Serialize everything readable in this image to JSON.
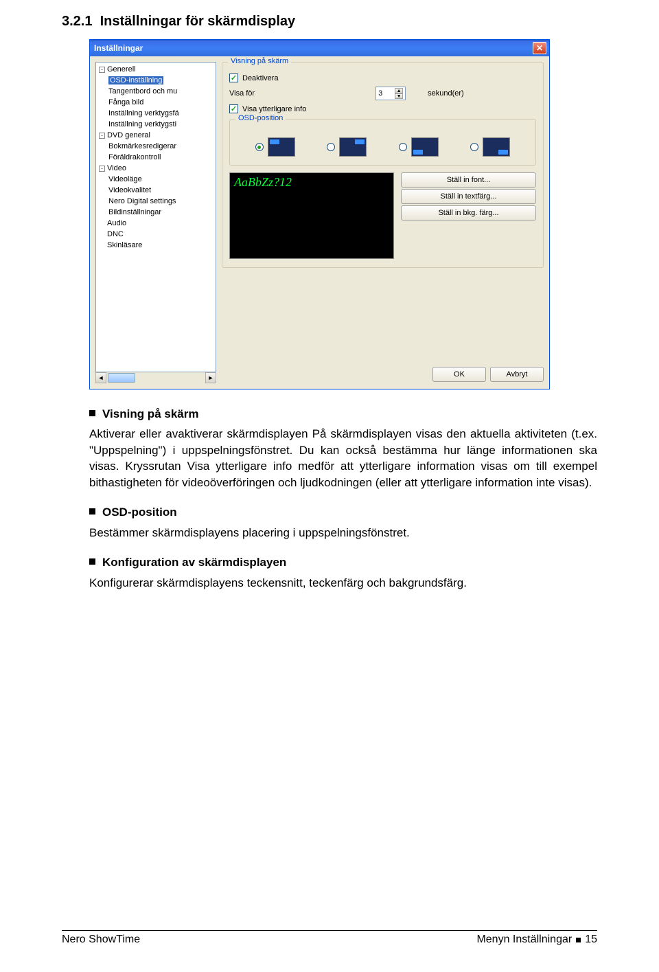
{
  "section": {
    "number": "3.2.1",
    "title": "Inställningar för skärmdisplay"
  },
  "window": {
    "title": "Inställningar",
    "tree": {
      "items": [
        {
          "label": "Generell",
          "level": 0,
          "box": "-"
        },
        {
          "label": "OSD-inställning",
          "level": 1,
          "selected": true
        },
        {
          "label": "Tangentbord och mu",
          "level": 1
        },
        {
          "label": "Fånga bild",
          "level": 1
        },
        {
          "label": "Inställning verktygsfä",
          "level": 1
        },
        {
          "label": "Inställning verktygsti",
          "level": 1
        },
        {
          "label": "DVD general",
          "level": 0,
          "box": "-"
        },
        {
          "label": "Bokmärkesredigerar",
          "level": 1
        },
        {
          "label": "Föräldrakontroll",
          "level": 1
        },
        {
          "label": "Video",
          "level": 0,
          "box": "-"
        },
        {
          "label": "Videoläge",
          "level": 1
        },
        {
          "label": "Videokvalitet",
          "level": 1
        },
        {
          "label": "Nero Digital settings",
          "level": 1
        },
        {
          "label": "Bildinställningar",
          "level": 1
        },
        {
          "label": "Audio",
          "level": 0
        },
        {
          "label": "DNC",
          "level": 0
        },
        {
          "label": "Skinläsare",
          "level": 0
        }
      ]
    },
    "panel1": {
      "legend": "Visning på skärm",
      "deactivate": "Deaktivera",
      "showFor": "Visa för",
      "seconds": "sekund(er)",
      "secVal": "3",
      "showExtra": "Visa ytterligare info"
    },
    "panel2": {
      "legend": "OSD-position"
    },
    "preview": {
      "sample": "AaBbZz?12",
      "btnFont": "Ställ in font...",
      "btnText": "Ställ in textfärg...",
      "btnBkg": "Ställ in bkg. färg..."
    },
    "buttons": {
      "ok": "OK",
      "cancel": "Avbryt"
    }
  },
  "body": {
    "b1_title": "Visning på skärm",
    "b1_text": "Aktiverar eller avaktiverar skärmdisplayen På skärmdisplayen visas den aktuella aktiviteten (t.ex. \"Uppspelning\") i uppspelningsfönstret. Du kan också bestämma hur länge informationen ska visas. Kryssrutan Visa ytterligare info medför att ytterligare information visas om till exempel bithastigheten för videoöverföringen och ljudkodningen (eller att ytterligare information inte visas).",
    "b2_title": "OSD-position",
    "b2_text": "Bestämmer skärmdisplayens placering i uppspelningsfönstret.",
    "b3_title": "Konfiguration av skärmdisplayen",
    "b3_text": "Konfigurerar skärmdisplayens teckensnitt, teckenfärg och bakgrundsfärg."
  },
  "footer": {
    "left": "Nero ShowTime",
    "rightLabel": "Menyn Inställningar",
    "page": "15"
  }
}
